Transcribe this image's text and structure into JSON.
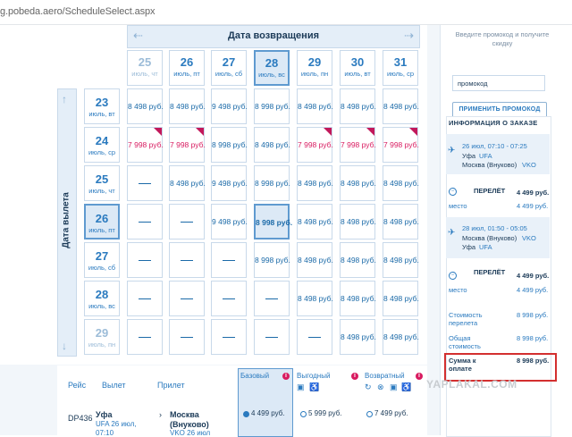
{
  "url": "g.pobeda.aero/ScheduleSelect.aspx",
  "return_header": {
    "label": "Дата возвращения",
    "prev": "⇠",
    "next": "⇢"
  },
  "depart_label": "Дата вылета",
  "col_dates": [
    {
      "d": "25",
      "w": "июль, чт"
    },
    {
      "d": "26",
      "w": "июль, пт"
    },
    {
      "d": "27",
      "w": "июль, сб"
    },
    {
      "d": "28",
      "w": "июль, вс"
    },
    {
      "d": "29",
      "w": "июль, пн"
    },
    {
      "d": "30",
      "w": "июль, вт"
    },
    {
      "d": "31",
      "w": "июль, ср"
    }
  ],
  "row_dates": [
    {
      "d": "23",
      "w": "июль, вт"
    },
    {
      "d": "24",
      "w": "июль, ср"
    },
    {
      "d": "25",
      "w": "июль, чт"
    },
    {
      "d": "26",
      "w": "июль, пт"
    },
    {
      "d": "27",
      "w": "июль, сб"
    },
    {
      "d": "28",
      "w": "июль, вс"
    },
    {
      "d": "29",
      "w": "июль, пн"
    }
  ],
  "grid": [
    [
      "8 498 руб.",
      "8 498 руб.",
      "9 498 руб.",
      "8 998 руб.",
      "8 498 руб.",
      "8 498 руб.",
      "8 498 руб."
    ],
    [
      "7 998 руб.",
      "7 998 руб.",
      "8 998 руб.",
      "8 498 руб.",
      "7 998 руб.",
      "7 998 руб.",
      "7 998 руб."
    ],
    [
      "—",
      "8 498 руб.",
      "9 498 руб.",
      "8 998 руб.",
      "8 498 руб.",
      "8 498 руб.",
      "8 498 руб."
    ],
    [
      "—",
      "—",
      "9 498 руб.",
      "8 998 руб.",
      "8 498 руб.",
      "8 498 руб.",
      "8 498 руб."
    ],
    [
      "—",
      "—",
      "—",
      "8 998 руб.",
      "8 498 руб.",
      "8 498 руб.",
      "8 498 руб."
    ],
    [
      "—",
      "—",
      "—",
      "—",
      "8 498 руб.",
      "8 498 руб.",
      "8 498 руб."
    ],
    [
      "—",
      "—",
      "—",
      "—",
      "—",
      "8 498 руб.",
      "8 498 руб."
    ]
  ],
  "flights_header": {
    "flight": "Рейс",
    "depart": "Вылет",
    "arrive": "Прилет"
  },
  "fares": [
    {
      "title": "Базовый",
      "price": "4 499 руб."
    },
    {
      "title": "Выгодный",
      "price": "5 999 руб."
    },
    {
      "title": "Возвратный",
      "price": "7 499 руб."
    }
  ],
  "flight_row": {
    "number": "DP436",
    "from_city": "Уфа",
    "from_detail": "UFA 26 июл,",
    "from_time": "07:10",
    "to_city": "Москва",
    "to_detail": "(Внуково)",
    "to_line2": "VKO 26 июл"
  },
  "promo": {
    "hint": "Введите промокод и получите скидку",
    "value": "промокод",
    "button": "ПРИМЕНИТЬ ПРОМОКОД"
  },
  "order": {
    "title": "ИНФОРМАЦИЯ О ЗАКАЗЕ",
    "seg1": {
      "date": "26 июл, 07:10 - 07:25",
      "from": "Уфа",
      "from_code": "UFA",
      "to": "Москва (Внуково)",
      "to_code": "VKO"
    },
    "flight1": {
      "label": "ПЕРЕЛЁТ",
      "price": "4 499 руб.",
      "seat": "место",
      "seat_price": "4 499 руб."
    },
    "seg2": {
      "date": "28 июл, 01:50 - 05:05",
      "from": "Москва (Внуково)",
      "from_code": "VKO",
      "to": "Уфа",
      "to_code": "UFA"
    },
    "flight2": {
      "label": "ПЕРЕЛЁТ",
      "price": "4 499 руб.",
      "seat": "место",
      "seat_price": "4 499 руб."
    },
    "cost_label": "Стоимость перелета",
    "cost": "8 998 руб.",
    "total_label": "Общая стоимость",
    "total": "8 998 руб.",
    "pay_label": "Сумма к оплате",
    "pay": "8 998 руб."
  },
  "watermark": "YAPLAKAL.COM"
}
